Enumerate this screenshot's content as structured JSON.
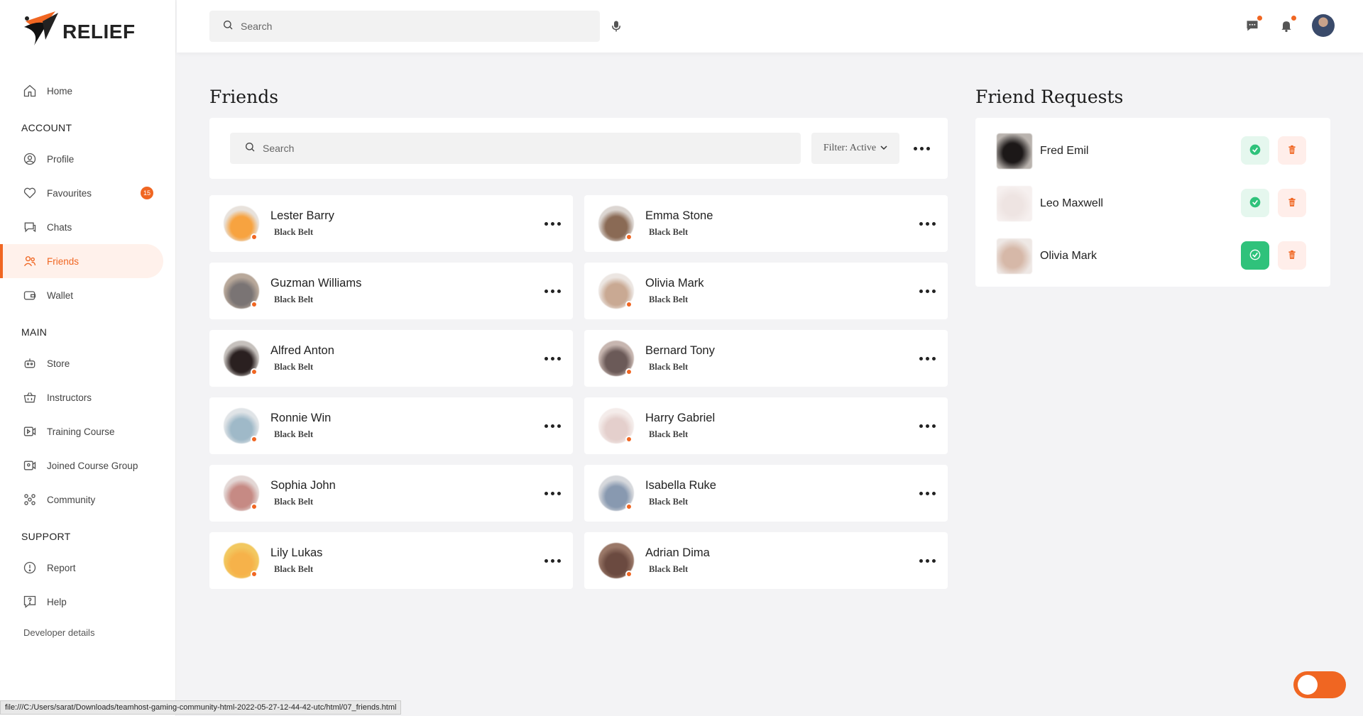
{
  "brand": {
    "name": "RELIEF"
  },
  "sidebar": {
    "home": "Home",
    "sections": {
      "account": "ACCOUNT",
      "main": "MAIN",
      "support": "SUPPORT"
    },
    "account_items": [
      {
        "label": "Profile",
        "icon": "user-circle-icon"
      },
      {
        "label": "Favourites",
        "icon": "heart-icon",
        "badge": "15"
      },
      {
        "label": "Chats",
        "icon": "chat-icon"
      },
      {
        "label": "Friends",
        "icon": "users-icon",
        "active": true
      },
      {
        "label": "Wallet",
        "icon": "wallet-icon"
      }
    ],
    "main_items": [
      {
        "label": "Store",
        "icon": "robot-icon"
      },
      {
        "label": "Instructors",
        "icon": "basket-icon"
      },
      {
        "label": "Training Course",
        "icon": "video-icon"
      },
      {
        "label": "Joined Course Group",
        "icon": "video-group-icon"
      },
      {
        "label": "Community",
        "icon": "community-icon"
      }
    ],
    "support_items": [
      {
        "label": "Report",
        "icon": "alert-circle-icon"
      },
      {
        "label": "Help",
        "icon": "help-icon"
      }
    ],
    "developer_link": "Developer details"
  },
  "header": {
    "search_placeholder": "Search"
  },
  "friends": {
    "title": "Friends",
    "search_placeholder": "Search",
    "filter_label": "Filter: Active",
    "list": [
      {
        "name": "Lester Barry",
        "rank": "Black Belt",
        "avatar": [
          "#f7a340",
          "#e8e2dc"
        ]
      },
      {
        "name": "Emma Stone",
        "rank": "Black Belt",
        "avatar": [
          "#8a6a55",
          "#dcd6d2"
        ]
      },
      {
        "name": "Guzman Williams",
        "rank": "Black Belt",
        "avatar": [
          "#7a7474",
          "#b8a89a"
        ]
      },
      {
        "name": "Olivia Mark",
        "rank": "Black Belt",
        "avatar": [
          "#c9a993",
          "#ece6e2"
        ]
      },
      {
        "name": "Alfred Anton",
        "rank": "Black Belt",
        "avatar": [
          "#2a2020",
          "#c6c1bd"
        ]
      },
      {
        "name": "Bernard Tony",
        "rank": "Black Belt",
        "avatar": [
          "#6b5a58",
          "#c7b6b0"
        ]
      },
      {
        "name": "Ronnie Win",
        "rank": "Black Belt",
        "avatar": [
          "#9fb9c8",
          "#e0e4e7"
        ]
      },
      {
        "name": "Harry Gabriel",
        "rank": "Black Belt",
        "avatar": [
          "#e4cfcc",
          "#f4ecea"
        ]
      },
      {
        "name": "Sophia John",
        "rank": "Black Belt",
        "avatar": [
          "#c68a84",
          "#e3d7d5"
        ]
      },
      {
        "name": "Isabella Ruke",
        "rank": "Black Belt",
        "avatar": [
          "#8899b0",
          "#d6d8dc"
        ]
      },
      {
        "name": "Lily Lukas",
        "rank": "Black Belt",
        "avatar": [
          "#f6b24a",
          "#f2c860"
        ]
      },
      {
        "name": "Adrian Dima",
        "rank": "Black Belt",
        "avatar": [
          "#6b4a40",
          "#9a7868"
        ]
      }
    ]
  },
  "requests": {
    "title": "Friend Requests",
    "list": [
      {
        "name": "Fred Emil",
        "avatar": [
          "#1c1818",
          "#b9b3ae"
        ],
        "accept_solid": false
      },
      {
        "name": "Leo Maxwell",
        "avatar": [
          "#eee4e2",
          "#f6f0ef"
        ],
        "accept_solid": false
      },
      {
        "name": "Olivia Mark",
        "avatar": [
          "#d6b8a8",
          "#eee8e5"
        ],
        "accept_solid": true
      }
    ]
  },
  "status_bar": "file:///C:/Users/sarat/Downloads/teamhost-gaming-community-html-2022-05-27-12-44-42-utc/html/07_friends.html",
  "colors": {
    "accent": "#f06622",
    "accept": "#2fc27b",
    "delete": "#f06622"
  }
}
